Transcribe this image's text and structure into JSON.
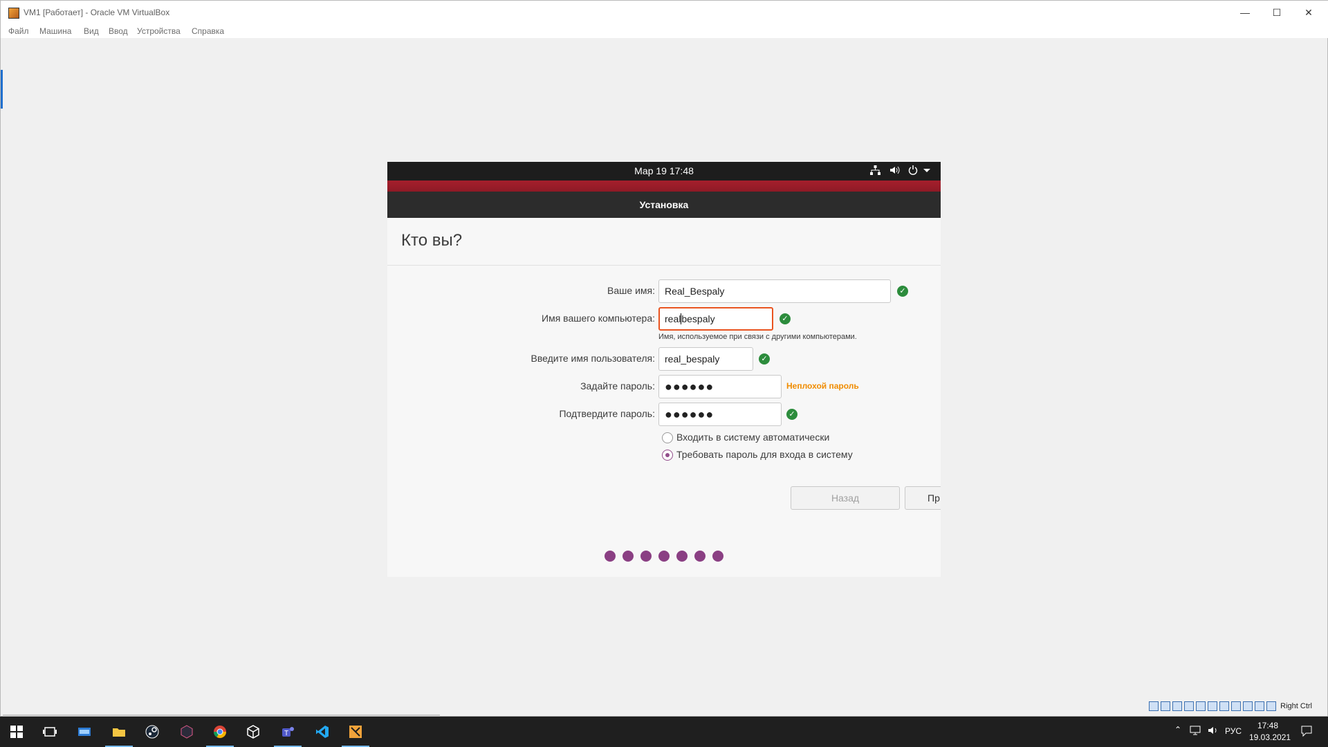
{
  "window": {
    "title": "VM1 [Работает] - Oracle VM VirtualBox",
    "minimize": "—",
    "maximize": "☐",
    "close": "✕"
  },
  "menu": [
    "Файл",
    "Машина",
    "Вид",
    "Ввод",
    "Устройства",
    "Справка"
  ],
  "guest": {
    "clock": "Мар 19  17:48",
    "header_title": "Установка",
    "page_title": "Кто вы?",
    "fields": {
      "name": {
        "label": "Ваше имя:",
        "value": "Real_Bespaly"
      },
      "computer": {
        "label": "Имя вашего компьютера:",
        "value_before_caret": "real",
        "value_after_caret": "bespaly",
        "hint": "Имя, используемое при связи с другими компьютерами."
      },
      "username": {
        "label": "Введите имя пользователя:",
        "value": "real_bespaly"
      },
      "password": {
        "label": "Задайте пароль:",
        "value": "●●●●●●",
        "strength": "Неплохой пароль"
      },
      "confirm": {
        "label": "Подтвердите пароль:",
        "value": "●●●●●●"
      }
    },
    "options": {
      "auto_login": "Входить в систему автоматически",
      "require_password": "Требовать пароль для входа в систему",
      "selected": "require_password"
    },
    "buttons": {
      "back": "Назад",
      "next": "Пр"
    },
    "progress_steps": 7
  },
  "statusbar": {
    "host_key": "Right Ctrl"
  },
  "taskbar": {
    "lang": "РУС",
    "time": "17:48",
    "date": "19.03.2021"
  },
  "colors": {
    "ubuntu_red": "#a51f2c",
    "ubuntu_orange": "#e95420",
    "ubuntu_purple": "#8a3f83",
    "check_green": "#2c8c3c",
    "strength_orange": "#f08c00"
  }
}
